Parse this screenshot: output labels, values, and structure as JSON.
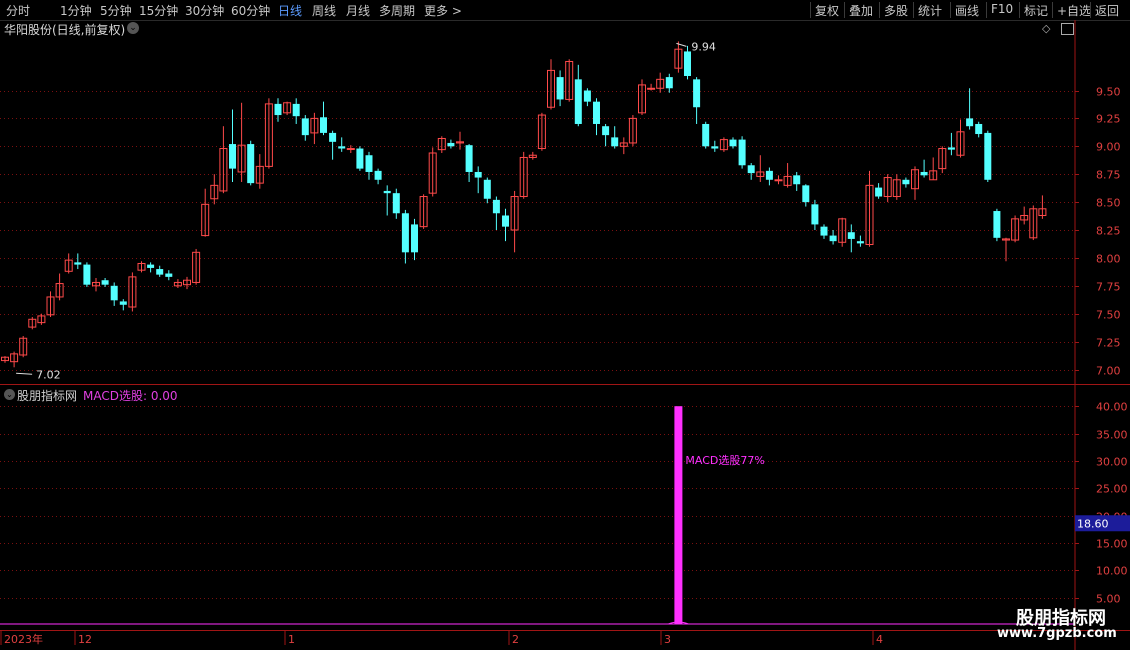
{
  "toolbar": {
    "periods": [
      "分时",
      "1分钟",
      "5分钟",
      "15分钟",
      "30分钟",
      "60分钟",
      "日线",
      "周线",
      "月线",
      "多周期",
      "更多 >"
    ],
    "active_period": "日线",
    "right_buttons": [
      "复权",
      "叠加",
      "多股",
      "统计",
      "画线",
      "F10",
      "标记",
      "+自选",
      "返回"
    ]
  },
  "colors": {
    "up": "#ff4a4a",
    "down": "#54ffff",
    "grid": "#7a1010",
    "axis": "#a01515",
    "indicator": "#ff30ff",
    "price_label": "#e04040",
    "highlight_bg": "#1c1c9a"
  },
  "main_title": "华阳股份(日线,前复权)",
  "indicator": {
    "name": "股朋指标网",
    "value_label": "MACD选股: 0.00",
    "annotation": "MACD选股77%",
    "current_value": "18.60"
  },
  "watermark": {
    "text": "股朋指标网",
    "url": "www.7gpzb.com"
  },
  "chart_data": [
    {
      "type": "candlestick",
      "title": "华阳股份(日线,前复权)",
      "ylim": [
        6.9,
        9.85
      ],
      "yticks": [
        "9.50",
        "9.25",
        "9.00",
        "8.75",
        "8.50",
        "8.25",
        "8.00",
        "7.75",
        "7.50",
        "7.25",
        "7.00"
      ],
      "annotations": {
        "high": "9.94",
        "low": "7.02"
      },
      "candles": [
        [
          7.08,
          7.11,
          7.06,
          7.12
        ],
        [
          7.07,
          7.14,
          7.02,
          7.16
        ],
        [
          7.13,
          7.28,
          7.11,
          7.3
        ],
        [
          7.38,
          7.45,
          7.36,
          7.47
        ],
        [
          7.42,
          7.48,
          7.4,
          7.5
        ],
        [
          7.49,
          7.65,
          7.47,
          7.7
        ],
        [
          7.65,
          7.77,
          7.62,
          7.86
        ],
        [
          7.88,
          7.98,
          7.86,
          8.04
        ],
        [
          7.96,
          7.94,
          7.9,
          8.04
        ],
        [
          7.94,
          7.76,
          7.74,
          7.96
        ],
        [
          7.75,
          7.78,
          7.7,
          7.82
        ],
        [
          7.8,
          7.76,
          7.74,
          7.82
        ],
        [
          7.75,
          7.62,
          7.57,
          7.78
        ],
        [
          7.61,
          7.58,
          7.53,
          7.63
        ],
        [
          7.56,
          7.83,
          7.52,
          7.87
        ],
        [
          7.89,
          7.95,
          7.87,
          7.97
        ],
        [
          7.94,
          7.91,
          7.87,
          7.96
        ],
        [
          7.9,
          7.85,
          7.83,
          7.93
        ],
        [
          7.86,
          7.83,
          7.8,
          7.89
        ],
        [
          7.75,
          7.78,
          7.73,
          7.81
        ],
        [
          7.76,
          7.8,
          7.72,
          7.83
        ],
        [
          7.78,
          8.05,
          7.76,
          8.08
        ],
        [
          8.2,
          8.48,
          8.19,
          8.62
        ],
        [
          8.53,
          8.65,
          8.48,
          8.75
        ],
        [
          8.6,
          8.98,
          8.58,
          9.18
        ],
        [
          9.02,
          8.8,
          8.68,
          9.33
        ],
        [
          8.77,
          9.01,
          8.68,
          9.39
        ],
        [
          9.02,
          8.67,
          8.65,
          9.05
        ],
        [
          8.67,
          8.82,
          8.62,
          8.93
        ],
        [
          8.82,
          9.38,
          8.8,
          9.43
        ],
        [
          9.38,
          9.28,
          9.22,
          9.43
        ],
        [
          9.3,
          9.39,
          9.28,
          9.4
        ],
        [
          9.38,
          9.27,
          9.2,
          9.43
        ],
        [
          9.25,
          9.1,
          9.05,
          9.28
        ],
        [
          9.12,
          9.25,
          9.02,
          9.3
        ],
        [
          9.26,
          9.12,
          9.1,
          9.4
        ],
        [
          9.12,
          9.04,
          8.88,
          9.14
        ],
        [
          9.0,
          8.98,
          8.95,
          9.08
        ],
        [
          8.98,
          8.98,
          8.94,
          9.01
        ],
        [
          8.98,
          8.8,
          8.78,
          9.0
        ],
        [
          8.92,
          8.77,
          8.7,
          8.95
        ],
        [
          8.78,
          8.7,
          8.66,
          8.8
        ],
        [
          8.6,
          8.58,
          8.38,
          8.65
        ],
        [
          8.58,
          8.4,
          8.35,
          8.62
        ],
        [
          8.4,
          8.05,
          7.95,
          8.43
        ],
        [
          8.3,
          8.05,
          7.98,
          8.35
        ],
        [
          8.28,
          8.55,
          8.26,
          8.57
        ],
        [
          8.58,
          8.94,
          8.55,
          8.99
        ],
        [
          8.97,
          9.07,
          8.94,
          9.09
        ],
        [
          9.03,
          9.0,
          8.98,
          9.06
        ],
        [
          9.03,
          9.04,
          8.97,
          9.13
        ],
        [
          9.01,
          8.77,
          8.68,
          9.02
        ],
        [
          8.77,
          8.72,
          8.58,
          8.82
        ],
        [
          8.7,
          8.53,
          8.49,
          8.72
        ],
        [
          8.52,
          8.4,
          8.25,
          8.55
        ],
        [
          8.38,
          8.28,
          8.15,
          8.44
        ],
        [
          8.25,
          8.55,
          8.05,
          8.6
        ],
        [
          8.55,
          8.9,
          8.53,
          8.95
        ],
        [
          8.9,
          8.92,
          8.88,
          8.95
        ],
        [
          8.98,
          9.28,
          8.96,
          9.3
        ],
        [
          9.35,
          9.68,
          9.33,
          9.78
        ],
        [
          9.62,
          9.42,
          9.36,
          9.68
        ],
        [
          9.42,
          9.76,
          9.4,
          9.78
        ],
        [
          9.6,
          9.2,
          9.18,
          9.73
        ],
        [
          9.5,
          9.4,
          9.36,
          9.52
        ],
        [
          9.4,
          9.2,
          9.1,
          9.43
        ],
        [
          9.18,
          9.1,
          9.0,
          9.2
        ],
        [
          9.08,
          9.0,
          8.98,
          9.18
        ],
        [
          9.0,
          9.03,
          8.93,
          9.08
        ],
        [
          9.03,
          9.25,
          9.0,
          9.28
        ],
        [
          9.3,
          9.55,
          9.28,
          9.6
        ],
        [
          9.52,
          9.52,
          9.5,
          9.56
        ],
        [
          9.52,
          9.6,
          9.48,
          9.66
        ],
        [
          9.62,
          9.52,
          9.48,
          9.65
        ],
        [
          9.7,
          9.87,
          9.66,
          9.94
        ],
        [
          9.85,
          9.63,
          9.6,
          9.9
        ],
        [
          9.6,
          9.35,
          9.2,
          9.62
        ],
        [
          9.2,
          9.0,
          8.98,
          9.22
        ],
        [
          9.0,
          8.98,
          8.95,
          9.05
        ],
        [
          8.97,
          9.06,
          8.95,
          9.08
        ],
        [
          9.06,
          9.0,
          8.98,
          9.08
        ],
        [
          9.06,
          8.83,
          8.8,
          9.09
        ],
        [
          8.83,
          8.76,
          8.7,
          8.85
        ],
        [
          8.73,
          8.77,
          8.68,
          8.92
        ],
        [
          8.78,
          8.7,
          8.65,
          8.81
        ],
        [
          8.7,
          8.7,
          8.66,
          8.74
        ],
        [
          8.65,
          8.73,
          8.63,
          8.85
        ],
        [
          8.74,
          8.66,
          8.6,
          8.77
        ],
        [
          8.65,
          8.5,
          8.46,
          8.66
        ],
        [
          8.48,
          8.3,
          8.25,
          8.52
        ],
        [
          8.28,
          8.2,
          8.17,
          8.3
        ],
        [
          8.2,
          8.15,
          8.12,
          8.25
        ],
        [
          8.14,
          8.35,
          8.1,
          8.36
        ],
        [
          8.23,
          8.17,
          8.05,
          8.3
        ],
        [
          8.15,
          8.13,
          8.1,
          8.2
        ],
        [
          8.12,
          8.65,
          8.1,
          8.78
        ],
        [
          8.63,
          8.55,
          8.53,
          8.67
        ],
        [
          8.55,
          8.72,
          8.5,
          8.75
        ],
        [
          8.55,
          8.7,
          8.52,
          8.75
        ],
        [
          8.7,
          8.66,
          8.63,
          8.72
        ],
        [
          8.62,
          8.79,
          8.52,
          8.82
        ],
        [
          8.77,
          8.74,
          8.72,
          8.88
        ],
        [
          8.7,
          8.78,
          8.7,
          8.9
        ],
        [
          8.8,
          8.98,
          8.76,
          9.0
        ],
        [
          8.99,
          8.97,
          8.92,
          9.12
        ],
        [
          8.92,
          9.13,
          8.9,
          9.24
        ],
        [
          9.25,
          9.18,
          9.15,
          9.52
        ],
        [
          9.2,
          9.11,
          9.08,
          9.22
        ],
        [
          9.12,
          8.7,
          8.68,
          9.14
        ],
        [
          8.42,
          8.18,
          8.15,
          8.44
        ],
        [
          8.16,
          8.17,
          7.97,
          8.18
        ],
        [
          8.16,
          8.35,
          8.14,
          8.38
        ],
        [
          8.34,
          8.38,
          8.3,
          8.46
        ],
        [
          8.18,
          8.44,
          8.16,
          8.47
        ],
        [
          8.38,
          8.44,
          8.35,
          8.56
        ]
      ]
    },
    {
      "type": "bar",
      "title": "MACD选股: 0.00",
      "ylim": [
        0,
        41
      ],
      "yticks": [
        "40.00",
        "35.00",
        "30.00",
        "25.00",
        "20.00",
        "15.00",
        "10.00",
        "5.00"
      ],
      "spike": {
        "candle_index": 74,
        "value": 40
      },
      "x_tick_labels": [
        "2023年",
        "12",
        "1",
        "2",
        "3",
        "4"
      ]
    }
  ]
}
